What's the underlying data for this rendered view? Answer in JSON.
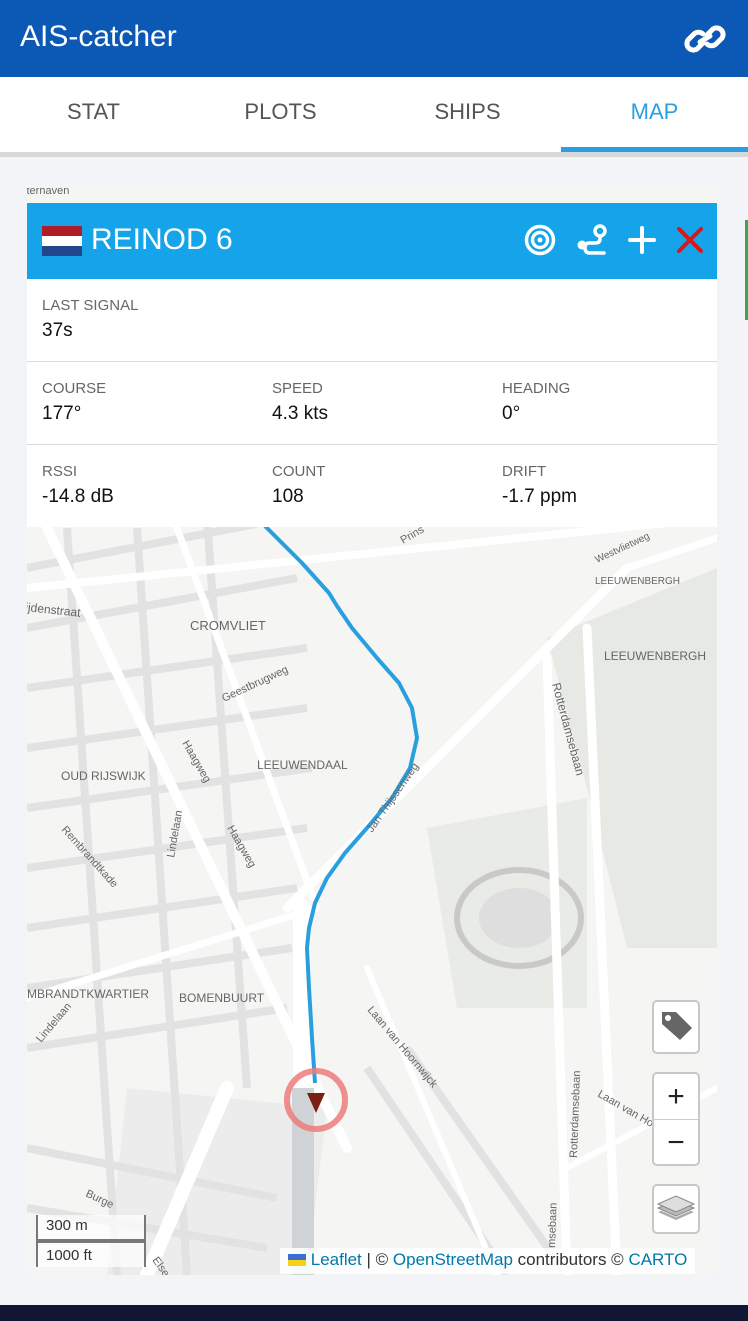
{
  "app": {
    "title": "AIS-catcher",
    "link_icon": "link-icon"
  },
  "tabs": [
    {
      "label": "STAT",
      "active": false
    },
    {
      "label": "PLOTS",
      "active": false
    },
    {
      "label": "SHIPS",
      "active": false
    },
    {
      "label": "MAP",
      "active": true
    }
  ],
  "popup": {
    "ship_name": "REINOD 6",
    "flag": "netherlands-flag",
    "header_color": "#15a4ea",
    "actions": [
      "target-icon",
      "route-icon",
      "plus-icon",
      "close-icon"
    ],
    "last_signal": {
      "label": "LAST SIGNAL",
      "value": "37s"
    },
    "course": {
      "label": "COURSE",
      "value": "177°"
    },
    "speed": {
      "label": "SPEED",
      "value": "4.3 kts"
    },
    "heading": {
      "label": "HEADING",
      "value": "0°"
    },
    "rssi": {
      "label": "RSSI",
      "value": "-14.8 dB"
    },
    "count": {
      "label": "COUNT",
      "value": "108"
    },
    "drift": {
      "label": "DRIFT",
      "value": "-1.7 ppm"
    }
  },
  "map": {
    "labels": {
      "cromvliet": "CROMVLIET",
      "leeuwenbergh": "LEEUWENBERGH",
      "leeuwenbergh_small": "LEEUWENBERGH",
      "oud_rijswijk": "OUD RIJSWIJK",
      "leeuwendaal": "LEEUWENDAAL",
      "rembrandtkwartier": "MBRANDTKWARTIER",
      "bomenbuurt": "BOMENBUURT",
      "geestbrugweg": "Geestbrugweg",
      "haagweg": "Haagweg",
      "haagweg2": "Haagweg",
      "lindelaan": "Lindelaan",
      "lindelaan2": "Lindelaan",
      "rembrandtkade": "Rembrandtkade",
      "jan_thijssenweg": "Jan Thijssenweg",
      "rotterdamsebaan": "Rotterdamsebaan",
      "rotterdamsebaan2": "Rotterdamsebaan",
      "rotterdamsebaan3": "msebaan",
      "laan_van_hoornwijck": "Laan van Hoornwijck",
      "laan_van_hoornwijck2": "Laan van Ho",
      "westvlietweg": "Westvlietweg",
      "rijdenstraat": "ijdenstraat",
      "sterhaven": "sterhaven",
      "prins": "Prins",
      "burge": "Burge",
      "else": "Else"
    },
    "track_color": "#2a9fe0",
    "ship_marker_color": "#7a1f14",
    "zoom_in": "+",
    "zoom_out": "−",
    "tag_icon": "tag-icon",
    "layers_icon": "layers-icon",
    "scale_metric": "300 m",
    "scale_imperial": "1000 ft",
    "attribution": {
      "leaflet": "Leaflet",
      "sep": " | © ",
      "osm": "OpenStreetMap",
      "contributors": " contributors © ",
      "carto": "CARTO"
    }
  }
}
